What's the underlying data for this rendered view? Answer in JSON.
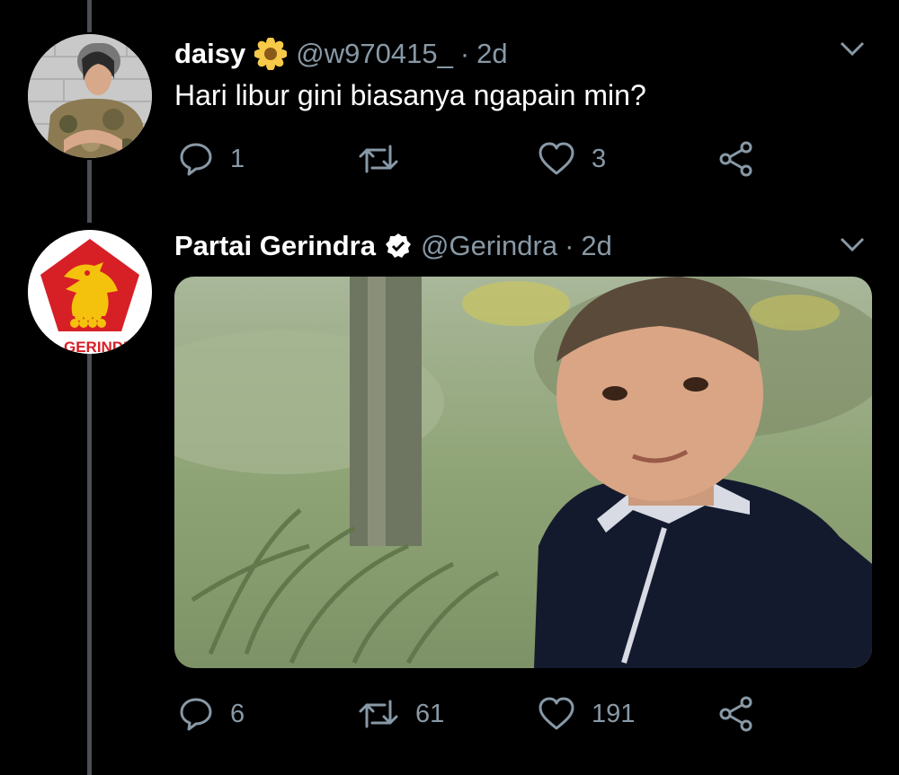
{
  "tweets": [
    {
      "name": "daisy",
      "name_badge": "sunflower-emoji",
      "handle": "@w970415_",
      "time": "2d",
      "text": "Hari libur gini biasanya ngapain min?",
      "replies": "1",
      "retweets": "",
      "likes": "3"
    },
    {
      "name": "Partai Gerindra",
      "name_badge": "verified-badge",
      "handle": "@Gerindra",
      "time": "2d",
      "logo_text": "GERINDRA",
      "replies": "6",
      "retweets": "61",
      "likes": "191"
    }
  ],
  "colors": {
    "background": "#000000",
    "muted": "#8899a6",
    "thread_line": "#4a4f55",
    "gerindra_red": "#d71f26",
    "gerindra_gold": "#f4c20d"
  }
}
